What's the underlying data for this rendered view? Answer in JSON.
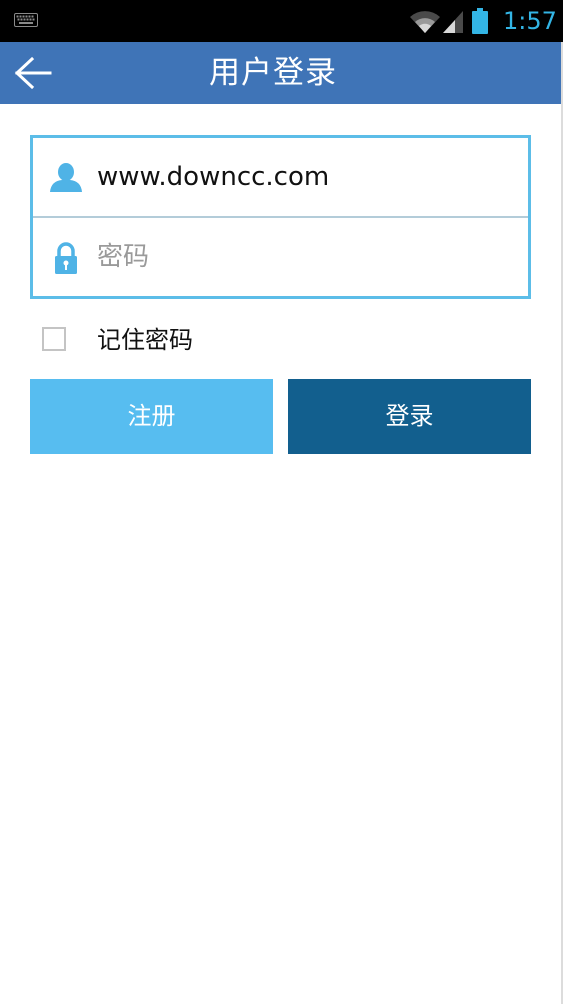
{
  "status_bar": {
    "time": "1:57",
    "icons": [
      "keyboard-icon",
      "wifi-icon",
      "signal-icon",
      "battery-icon"
    ],
    "time_color": "#33b5e5"
  },
  "header": {
    "title": "用户登录",
    "back_icon": "arrow-left-icon",
    "background_color": "#3f74b7"
  },
  "form": {
    "username": {
      "value": "www.downcc.com",
      "icon": "user-icon"
    },
    "password": {
      "placeholder": "密码",
      "value": "",
      "icon": "lock-icon"
    },
    "border_color": "#5cbde8",
    "remember": {
      "label": "记住密码",
      "checked": false
    }
  },
  "actions": {
    "register_label": "注册",
    "login_label": "登录",
    "register_color": "#57bdf0",
    "login_color": "#125f8e"
  }
}
